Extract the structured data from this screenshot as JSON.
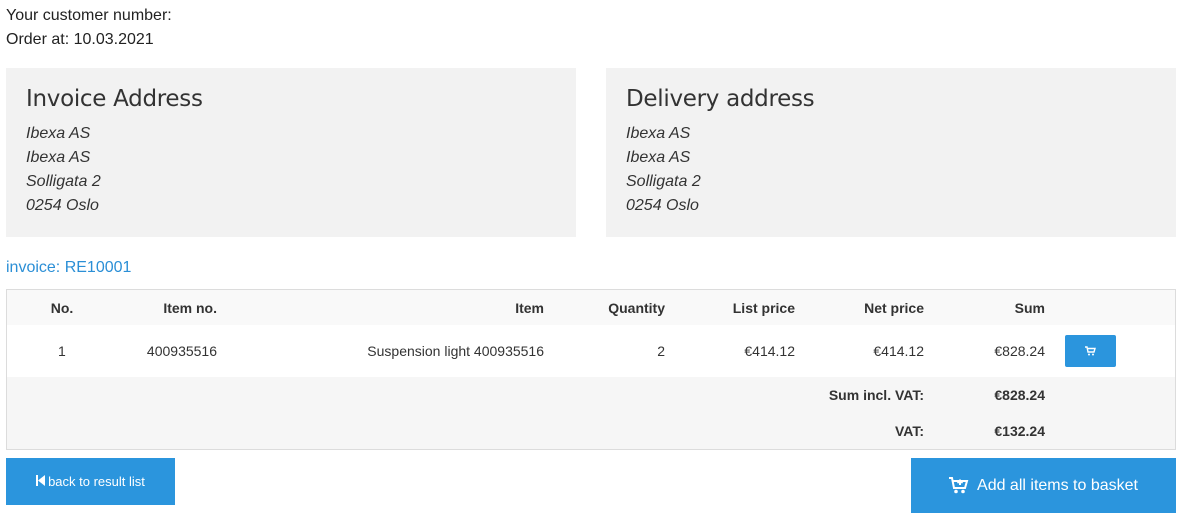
{
  "header": {
    "customer_number_label": "Your customer number:",
    "order_date_label": "Order at: 10.03.2021"
  },
  "invoice_address": {
    "title": "Invoice Address",
    "lines": [
      "Ibexa AS",
      "Ibexa AS",
      "Solligata 2",
      "0254 Oslo"
    ]
  },
  "delivery_address": {
    "title": "Delivery address",
    "lines": [
      "Ibexa AS",
      "Ibexa AS",
      "Solligata 2",
      "0254 Oslo"
    ]
  },
  "invoice_link": "invoice: RE10001",
  "table": {
    "headers": [
      "No.",
      "Item no.",
      "Item",
      "Quantity",
      "List price",
      "Net price",
      "Sum"
    ],
    "rows": [
      {
        "no": "1",
        "item_no": "400935516",
        "item": "Suspension light 400935516",
        "quantity": "2",
        "list_price": "€414.12",
        "net_price": "€414.12",
        "sum": "€828.24",
        "cart_icon": "cart-icon"
      }
    ],
    "sum_incl_vat_label": "Sum incl. VAT:",
    "sum_incl_vat": "€828.24",
    "vat_label": "VAT:",
    "vat": "€132.24"
  },
  "buttons": {
    "back_label": "back to result list",
    "back_icon": "step-backward-icon",
    "add_all_label": "Add all items to basket",
    "add_all_icon": "cart-plus-icon"
  },
  "colors": {
    "accent": "#2b95dd",
    "link": "#2b8fd6",
    "panel_bg": "#f2f2f2"
  }
}
